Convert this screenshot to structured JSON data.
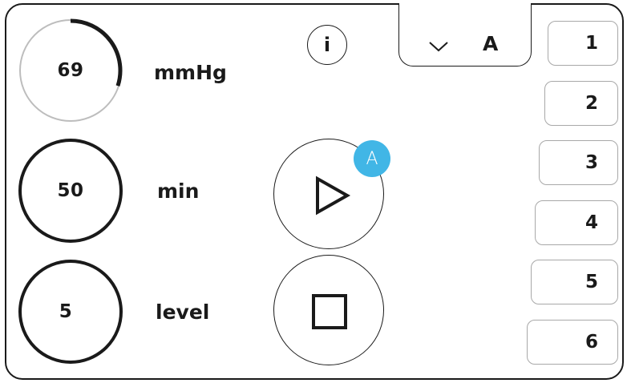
{
  "pressure": {
    "value": "69",
    "unit": "mmHg",
    "fraction": 0.3
  },
  "time": {
    "value": "50",
    "unit": "min"
  },
  "intensity": {
    "value": "5",
    "unit": "level"
  },
  "info": {
    "label": "i"
  },
  "mode_selector": {
    "label": "A",
    "icon": "chevron-down-icon"
  },
  "start": {
    "icon": "play-icon",
    "badge": "A",
    "badge_color": "#41b6e6"
  },
  "stop": {
    "icon": "stop-icon"
  },
  "presets": [
    {
      "label": "1"
    },
    {
      "label": "2"
    },
    {
      "label": "3"
    },
    {
      "label": "4"
    },
    {
      "label": "5"
    },
    {
      "label": "6"
    }
  ]
}
